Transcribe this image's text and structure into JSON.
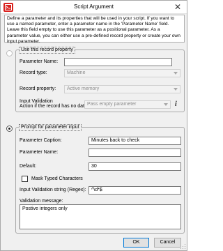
{
  "window": {
    "title": "Script Argument",
    "close_glyph": "✕",
    "app_icon": "script-app-icon",
    "accent_color": "#d9211e"
  },
  "intro_text": "Define a parameter and its properties that will be used in your script. If you want to use a named parameter, enter a parameter name in the 'Parameter Name' field. Leave this field empty to use this parameter as a positional parameter. As a parameter value, you can either use a pre-defined record property or create your own input parameter.",
  "record_group": {
    "legend": "Use this record property",
    "selected": false,
    "parameter_name_label": "Parameter Name:",
    "parameter_name_value": "",
    "record_type_label": "Record type:",
    "record_type_value": "Machine",
    "record_property_label": "Record property:",
    "record_property_value": "Active memory",
    "input_validation_label": "Input Validation",
    "no_data_label": "Action if the record has no data",
    "no_data_value": "Pass empty parameter",
    "info_glyph": "i"
  },
  "prompt_group": {
    "legend": "Prompt for parameter input",
    "selected": true,
    "caption_label": "Parameter Caption:",
    "caption_value": "Minutes back to check",
    "name_label": "Parameter Name:",
    "name_value": "",
    "default_label": "Default:",
    "default_value": "30",
    "mask_label": "Mask Typed Characters",
    "mask_checked": false,
    "regex_label": "Input Validation string (Regex):",
    "regex_value": "^\\d*$",
    "validation_message_label": "Validation message:",
    "validation_message_value": "Postive integers only"
  },
  "buttons": {
    "ok": "OK",
    "cancel": "Cancel"
  }
}
